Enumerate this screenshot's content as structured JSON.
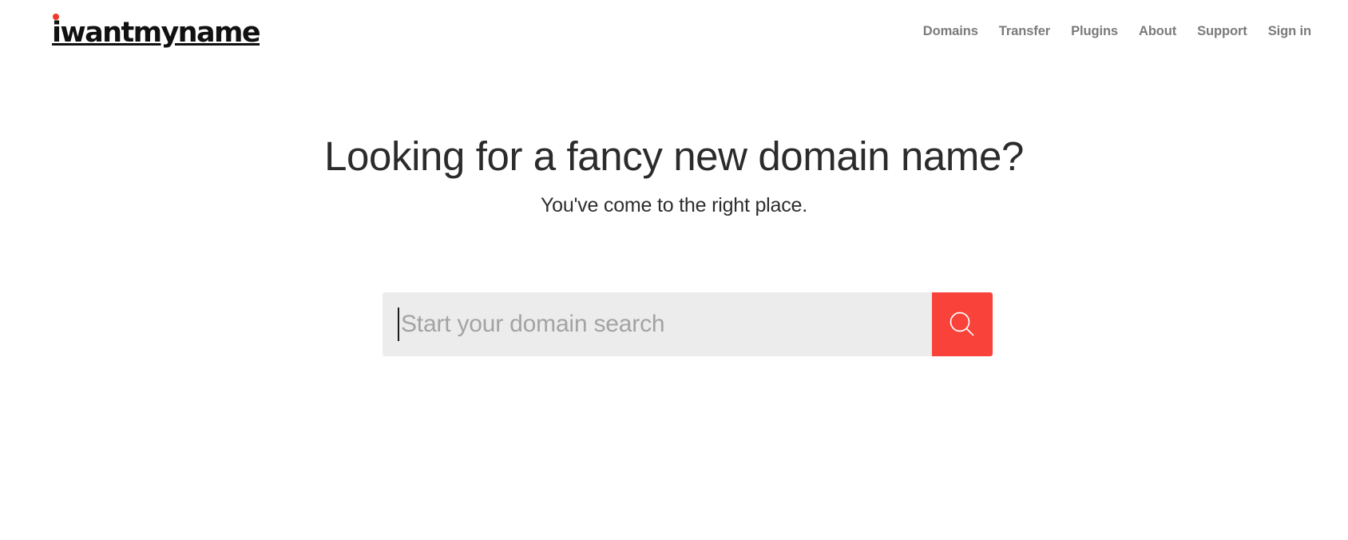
{
  "header": {
    "logo": {
      "text": "iwantmyname",
      "dot_color": "#f0392b",
      "dot_icon": "red-dot-icon"
    },
    "nav": [
      {
        "label": "Domains"
      },
      {
        "label": "Transfer"
      },
      {
        "label": "Plugins"
      },
      {
        "label": "About"
      },
      {
        "label": "Support"
      },
      {
        "label": "Sign in"
      }
    ]
  },
  "hero": {
    "title": "Looking for a fancy new domain name?",
    "subtitle": "You've come to the right place."
  },
  "search": {
    "value": "",
    "placeholder": "Start your domain search",
    "focused": true,
    "button_icon": "search-icon",
    "button_color": "#f9423a",
    "field_color": "#ececec"
  },
  "colors": {
    "page_background": "#ffffff",
    "accent": "#f9423a",
    "nav_text": "#7b7b7b",
    "heading_text": "#2b2b2b",
    "placeholder_text": "#a3a3a3"
  }
}
